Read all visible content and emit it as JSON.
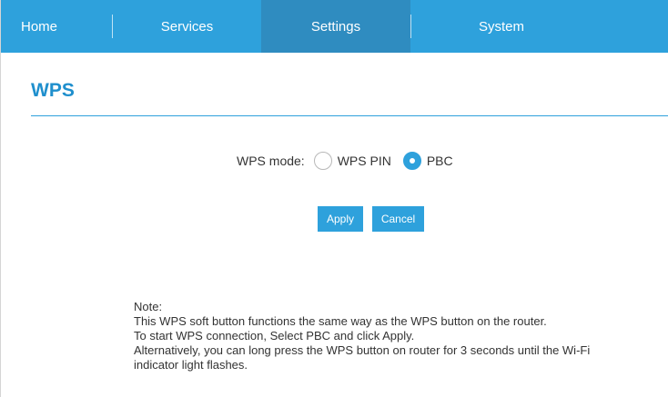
{
  "nav": {
    "home": "Home",
    "services": "Services",
    "settings": "Settings",
    "system": "System",
    "active": "Settings"
  },
  "page": {
    "title": "WPS"
  },
  "wps": {
    "mode_label": "WPS mode:",
    "options": [
      {
        "label": "WPS PIN",
        "selected": false
      },
      {
        "label": "PBC",
        "selected": true
      }
    ]
  },
  "buttons": {
    "apply": "Apply",
    "cancel": "Cancel"
  },
  "note": {
    "heading": "Note:",
    "lines": [
      "This WPS soft button functions the same way as the WPS button on the router.",
      "To start WPS connection, Select PBC and click Apply.",
      "Alternatively, you can long press the WPS button on router for 3 seconds until the Wi-Fi",
      "indicator light flashes."
    ]
  },
  "colors": {
    "accent": "#2ea1dc",
    "nav_active": "#2f8cc0",
    "title": "#1f8fcd",
    "text": "#333333"
  }
}
